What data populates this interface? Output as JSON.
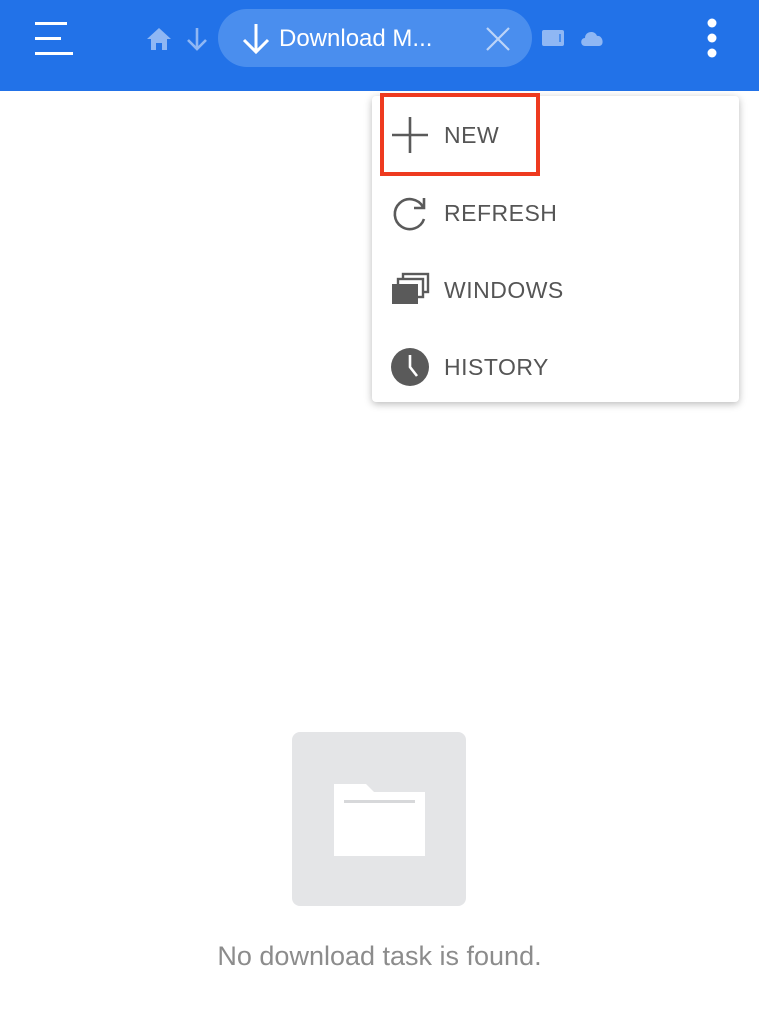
{
  "app_bar": {
    "active_tab": {
      "label": "Download M..."
    },
    "icons": [
      "menu-icon",
      "home-icon",
      "download-icon",
      "download-icon",
      "close-icon",
      "tablet-icon",
      "cloud-icon",
      "more-vert-icon"
    ]
  },
  "menu": {
    "items": [
      {
        "label": "NEW",
        "icon": "plus-icon"
      },
      {
        "label": "REFRESH",
        "icon": "refresh-icon"
      },
      {
        "label": "WINDOWS",
        "icon": "windows-icon"
      },
      {
        "label": "HISTORY",
        "icon": "clock-icon"
      }
    ],
    "highlighted_item": "NEW"
  },
  "empty_state": {
    "message": "No download task is found.",
    "icon": "folder-icon"
  },
  "colors": {
    "app_bar": "#2272e8",
    "tab_pill": "#4a8eee",
    "highlight": "#ee3a1f",
    "empty_tile": "#e4e5e7"
  }
}
